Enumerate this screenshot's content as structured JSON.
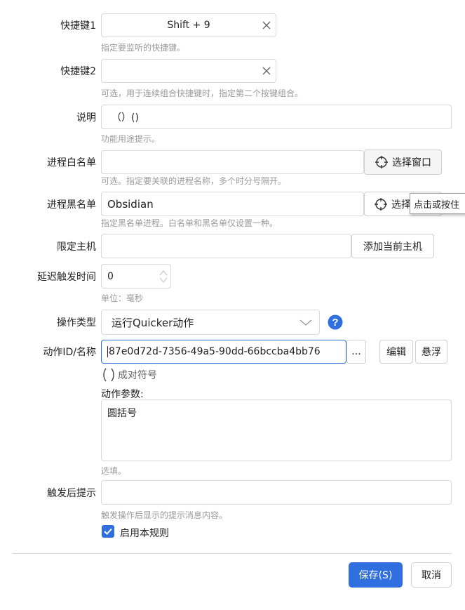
{
  "fields": {
    "hotkey1": {
      "label": "快捷键1",
      "value": "Shift + 9",
      "hint": "指定要监听的快捷键。"
    },
    "hotkey2": {
      "label": "快捷键2",
      "value": "",
      "hint": "可选，用于连续组合快捷键时，指定第二个按键组合。"
    },
    "description": {
      "label": "说明",
      "value": "（）()",
      "hint": "功能用途提示。"
    },
    "process_whitelist": {
      "label": "进程白名单",
      "value": "",
      "button": "选择窗口",
      "hint": "可选。指定要关联的进程名称，多个时分号隔开。"
    },
    "process_blacklist": {
      "label": "进程黑名单",
      "value": "Obsidian",
      "button": "选择",
      "hint": "指定黑名单进程。白名单和黑名单仅设置一种。"
    },
    "host_limit": {
      "label": "限定主机",
      "value": "",
      "button": "添加当前主机"
    },
    "delay": {
      "label": "延迟触发时间",
      "value": "0",
      "hint": "单位：毫秒"
    },
    "action_type": {
      "label": "操作类型",
      "value": "运行Quicker动作"
    },
    "action_id": {
      "label": "动作ID/名称",
      "value": "87e0d72d-7356-49a5-90dd-66bccba4bb76",
      "more_button": "...",
      "edit_button": "编辑",
      "float_button": "悬浮",
      "action_name": "成对符号"
    },
    "action_params": {
      "label": "动作参数:",
      "value": "圆括号",
      "hint": "选填。"
    },
    "after_trigger": {
      "label": "触发后提示",
      "value": "",
      "hint": "触发操作后显示的提示消息内容。"
    },
    "enable_rule": {
      "label": "启用本规则",
      "checked": true
    }
  },
  "tooltip": "点击或按住",
  "footer": {
    "save": "保存(S)",
    "cancel": "取消"
  },
  "colors": {
    "accent": "#2f6fe0",
    "hint": "#9a9a9a",
    "border": "#d9d9d9"
  }
}
